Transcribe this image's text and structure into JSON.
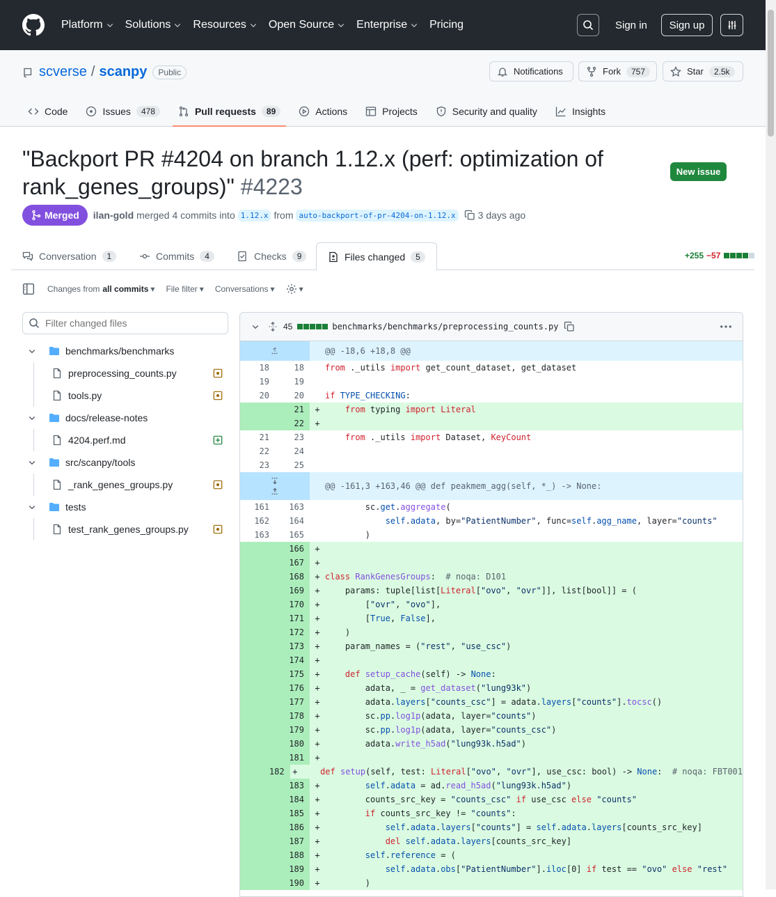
{
  "header": {
    "nav": [
      "Platform",
      "Solutions",
      "Resources",
      "Open Source",
      "Enterprise",
      "Pricing"
    ],
    "nav_has_chevron": [
      true,
      true,
      true,
      true,
      true,
      false
    ],
    "sign_in": "Sign in",
    "sign_up": "Sign up"
  },
  "repo": {
    "owner": "scverse",
    "sep": "/",
    "name": "scanpy",
    "visibility": "Public",
    "notifications": "Notifications",
    "fork_label": "Fork",
    "fork_count": "757",
    "star_label": "Star",
    "star_count": "2.5k",
    "tabs": [
      {
        "label": "Code",
        "count": ""
      },
      {
        "label": "Issues",
        "count": "478"
      },
      {
        "label": "Pull requests",
        "count": "89"
      },
      {
        "label": "Actions",
        "count": ""
      },
      {
        "label": "Projects",
        "count": ""
      },
      {
        "label": "Security and quality",
        "count": ""
      },
      {
        "label": "Insights",
        "count": ""
      }
    ]
  },
  "pr": {
    "title": "\"Backport PR #4204 on branch 1.12.x (perf: optimization of rank_genes_groups)\"",
    "number": "#4223",
    "new_issue": "New issue",
    "state": "Merged",
    "author": "ilan-gold",
    "merged_text": "merged 4 commits into",
    "base": "1.12.x",
    "from": "from",
    "head": "auto-backport-of-pr-4204-on-1.12.x",
    "when": "3 days ago",
    "tabs": [
      {
        "label": "Conversation",
        "count": "1"
      },
      {
        "label": "Commits",
        "count": "4"
      },
      {
        "label": "Checks",
        "count": "9"
      },
      {
        "label": "Files changed",
        "count": "5"
      }
    ],
    "additions": "+255",
    "deletions": "−57"
  },
  "toolbar": {
    "changes_from": "Changes from",
    "all_commits": "all commits",
    "file_filter": "File filter",
    "conversations": "Conversations"
  },
  "tree": {
    "filter_placeholder": "Filter changed files",
    "items": [
      {
        "type": "folder",
        "label": "benchmarks/benchmarks"
      },
      {
        "type": "file",
        "label": "preprocessing_counts.py",
        "status": "modified"
      },
      {
        "type": "file",
        "label": "tools.py",
        "status": "modified"
      },
      {
        "type": "folder",
        "label": "docs/release-notes"
      },
      {
        "type": "file",
        "label": "4204.perf.md",
        "status": "added"
      },
      {
        "type": "folder",
        "label": "src/scanpy/tools"
      },
      {
        "type": "file",
        "label": "_rank_genes_groups.py",
        "status": "modified"
      },
      {
        "type": "folder",
        "label": "tests"
      },
      {
        "type": "file",
        "label": "test_rank_genes_groups.py",
        "status": "modified"
      }
    ]
  },
  "diff": {
    "changed_count": "45",
    "filename": "benchmarks/benchmarks/preprocessing_counts.py",
    "lines": [
      {
        "t": "hunk",
        "h": "html",
        "c": "@@ -18,6 +18,8 @@"
      },
      {
        "t": "ctx",
        "a": "18",
        "b": "18",
        "h": "<span class=\"kw\">from</span> ._utils <span class=\"kw\">import</span> get_count_dataset, get_dataset"
      },
      {
        "t": "ctx",
        "a": "19",
        "b": "19",
        "h": ""
      },
      {
        "t": "ctx",
        "a": "20",
        "b": "20",
        "h": "<span class=\"kw\">if</span> <span class=\"nm\">TYPE_CHECKING</span>:"
      },
      {
        "t": "add",
        "a": "",
        "b": "21",
        "h": "    <span class=\"kw\">from</span> typing <span class=\"kw\">import</span> <span class=\"kw\">Literal</span>"
      },
      {
        "t": "add",
        "a": "",
        "b": "22",
        "h": ""
      },
      {
        "t": "ctx",
        "a": "21",
        "b": "23",
        "h": "    <span class=\"kw\">from</span> ._utils <span class=\"kw\">import</span> Dataset, <span class=\"kw\">KeyCount</span>"
      },
      {
        "t": "ctx",
        "a": "22",
        "b": "24",
        "h": ""
      },
      {
        "t": "ctx",
        "a": "23",
        "b": "25",
        "h": ""
      },
      {
        "t": "hunk2",
        "c": "@@ -161,3 +163,46 @@ def peakmem_agg(self, *_) -> None:"
      },
      {
        "t": "ctx",
        "a": "161",
        "b": "163",
        "h": "        sc.<span class=\"nm\">get</span>.<span class=\"fn\">aggregate</span>("
      },
      {
        "t": "ctx",
        "a": "162",
        "b": "164",
        "h": "            <span class=\"nm\">self</span>.<span class=\"nm\">adata</span>, by=<span class=\"st\">\"PatientNumber\"</span>, func=<span class=\"nm\">self</span>.<span class=\"nm\">agg_name</span>, layer=<span class=\"st\">\"counts\"</span>"
      },
      {
        "t": "ctx",
        "a": "163",
        "b": "165",
        "h": "        )"
      },
      {
        "t": "add",
        "a": "",
        "b": "166",
        "h": ""
      },
      {
        "t": "add",
        "a": "",
        "b": "167",
        "h": ""
      },
      {
        "t": "add",
        "a": "",
        "b": "168",
        "h": "<span class=\"kw\">class</span> <span class=\"fn\">RankGenesGroups</span>:  <span class=\"cm\"># noqa: D101</span>"
      },
      {
        "t": "add",
        "a": "",
        "b": "169",
        "h": "    params: tuple[list[<span class=\"kw\">Literal</span>[<span class=\"st\">\"ovo\"</span>, <span class=\"st\">\"ovr\"</span>]], list[bool]] = ("
      },
      {
        "t": "add",
        "a": "",
        "b": "170",
        "h": "        [<span class=\"st\">\"ovr\"</span>, <span class=\"st\">\"ovo\"</span>],"
      },
      {
        "t": "add",
        "a": "",
        "b": "171",
        "h": "        [<span class=\"nm\">True</span>, <span class=\"nm\">False</span>],"
      },
      {
        "t": "add",
        "a": "",
        "b": "172",
        "h": "    )"
      },
      {
        "t": "add",
        "a": "",
        "b": "173",
        "h": "    param_names = (<span class=\"st\">\"rest\"</span>, <span class=\"st\">\"use_csc\"</span>)"
      },
      {
        "t": "add",
        "a": "",
        "b": "174",
        "h": ""
      },
      {
        "t": "add",
        "a": "",
        "b": "175",
        "h": "    <span class=\"kw\">def</span> <span class=\"fn\">setup_cache</span>(self) -&gt; <span class=\"nm\">None</span>:"
      },
      {
        "t": "add",
        "a": "",
        "b": "176",
        "h": "        adata, _ = <span class=\"fn\">get_dataset</span>(<span class=\"st\">\"lung93k\"</span>)"
      },
      {
        "t": "add",
        "a": "",
        "b": "177",
        "h": "        adata.<span class=\"nm\">layers</span>[<span class=\"st\">\"counts_csc\"</span>] = adata.<span class=\"nm\">layers</span>[<span class=\"st\">\"counts\"</span>].<span class=\"fn\">tocsc</span>()"
      },
      {
        "t": "add",
        "a": "",
        "b": "178",
        "h": "        sc.<span class=\"nm\">pp</span>.<span class=\"fn\">log1p</span>(adata, layer=<span class=\"st\">\"counts\"</span>)"
      },
      {
        "t": "add",
        "a": "",
        "b": "179",
        "h": "        sc.<span class=\"nm\">pp</span>.<span class=\"fn\">log1p</span>(adata, layer=<span class=\"st\">\"counts_csc\"</span>)"
      },
      {
        "t": "add",
        "a": "",
        "b": "180",
        "h": "        adata.<span class=\"fn\">write_h5ad</span>(<span class=\"st\">\"lung93k.h5ad\"</span>)"
      },
      {
        "t": "add",
        "a": "",
        "b": "181",
        "h": ""
      },
      {
        "t": "add",
        "a": "",
        "b": "182",
        "h": "    <span class=\"kw\">def</span> <span class=\"fn\">setup</span>(self, test: <span class=\"kw\">Literal</span>[<span class=\"st\">\"ovo\"</span>, <span class=\"st\">\"ovr\"</span>], use_csc: bool) -&gt; <span class=\"nm\">None</span>:  <span class=\"cm\"># noqa: FBT001</span>"
      },
      {
        "t": "add",
        "a": "",
        "b": "183",
        "h": "        <span class=\"nm\">self</span>.<span class=\"nm\">adata</span> = ad.<span class=\"fn\">read_h5ad</span>(<span class=\"st\">\"lung93k.h5ad\"</span>)"
      },
      {
        "t": "add",
        "a": "",
        "b": "184",
        "h": "        counts_src_key = <span class=\"st\">\"counts_csc\"</span> <span class=\"kw\">if</span> use_csc <span class=\"kw\">else</span> <span class=\"st\">\"counts\"</span>"
      },
      {
        "t": "add",
        "a": "",
        "b": "185",
        "h": "        <span class=\"kw\">if</span> counts_src_key != <span class=\"st\">\"counts\"</span>:"
      },
      {
        "t": "add",
        "a": "",
        "b": "186",
        "h": "            <span class=\"nm\">self</span>.<span class=\"nm\">adata</span>.<span class=\"nm\">layers</span>[<span class=\"st\">\"counts\"</span>] = <span class=\"nm\">self</span>.<span class=\"nm\">adata</span>.<span class=\"nm\">layers</span>[counts_src_key]"
      },
      {
        "t": "add",
        "a": "",
        "b": "187",
        "h": "            <span class=\"kw\">del</span> <span class=\"nm\">self</span>.<span class=\"nm\">adata</span>.<span class=\"nm\">layers</span>[counts_src_key]"
      },
      {
        "t": "add",
        "a": "",
        "b": "188",
        "h": "        <span class=\"nm\">self</span>.<span class=\"nm\">reference</span> = ("
      },
      {
        "t": "add",
        "a": "",
        "b": "189",
        "h": "            <span class=\"nm\">self</span>.<span class=\"nm\">adata</span>.<span class=\"nm\">obs</span>[<span class=\"st\">\"PatientNumber\"</span>].<span class=\"nm\">iloc</span>[0] <span class=\"kw\">if</span> test == <span class=\"st\">\"ovo\"</span> <span class=\"kw\">else</span> <span class=\"st\">\"rest\"</span>"
      },
      {
        "t": "add",
        "a": "",
        "b": "190",
        "h": "        )"
      }
    ]
  },
  "colors": {
    "merged": "#8250df",
    "addition": "#1a7f37",
    "deletion": "#d1242f",
    "link": "#0969da",
    "header_bg": "#24292f"
  }
}
